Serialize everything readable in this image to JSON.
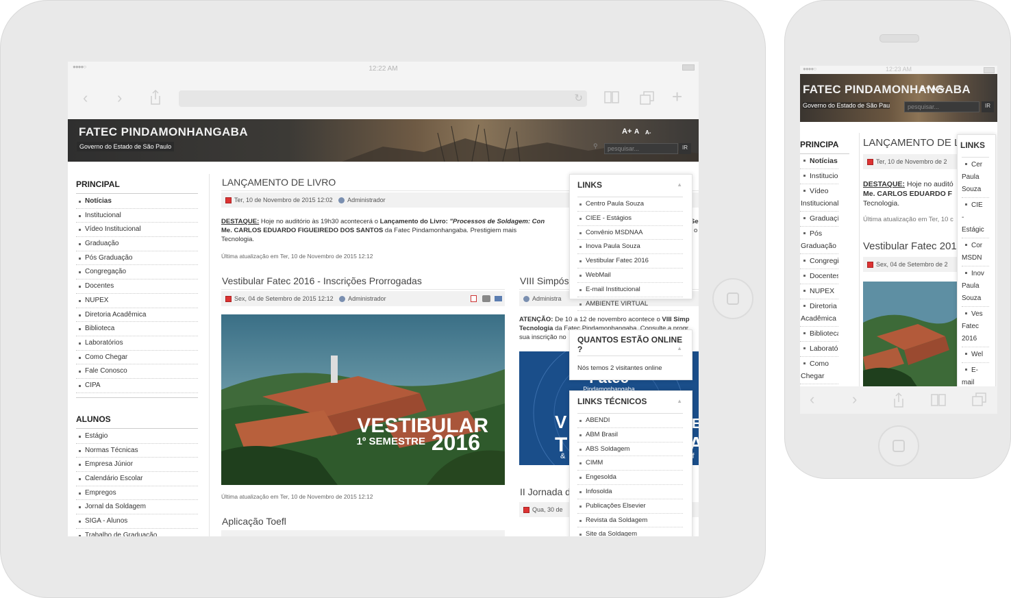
{
  "tablet": {
    "status": {
      "time": "12:22 AM",
      "signal": "●●●●○"
    },
    "header": {
      "title": "FATEC PINDAMONHANGABA",
      "subtitle": "Governo do Estado de São Paulo",
      "font_controls": [
        "A+",
        "A",
        "A-"
      ],
      "search_placeholder": "pesquisar...",
      "search_button": "IR"
    },
    "sidebar": {
      "principal_title": "PRINCIPAL",
      "principal_items": [
        "Notícias",
        "Institucional",
        "Vídeo Institucional",
        "Graduação",
        "Pós Graduação",
        "Congregação",
        "Docentes",
        "NUPEX",
        "Diretoria Acadêmica",
        "Biblioteca",
        "Laboratórios",
        "Como Chegar",
        "Fale Conosco",
        "CIPA"
      ],
      "alunos_title": "ALUNOS",
      "alunos_items": [
        "Estágio",
        "Normas Técnicas",
        "Empresa Júnior",
        "Calendário Escolar",
        "Empregos",
        "Jornal da Soldagem",
        "SIGA - Alunos",
        "Trabalho de Graduação"
      ]
    },
    "article1": {
      "title": "LANÇAMENTO DE LIVRO",
      "date": "Ter, 10 de Novembro de 2015 12:02",
      "author": "Administrador",
      "label": "DESTAQUE:",
      "text1": "Hoje no auditório às 19h30 acontecerá o ",
      "bold1": "Lançamento do Livro: ",
      "italic1": "\"Processos de Soldagem: Con",
      "bold2": "Me. CARLOS EDUARDO FIGUEIREDO DOS SANTOS",
      "text2": " da Fatec Pindamonhangaba. Prestigiem mais",
      "text3": "Tecnologia.",
      "updated": "Última atualização em Ter, 10 de Novembro de 2015 12:12"
    },
    "article2": {
      "title": "Vestibular Fatec 2016 - Inscrições Prorrogadas",
      "date": "Sex, 04 de Setembro de 2015 12:12",
      "author": "Administrador",
      "banner_big": "VESTIBULAR",
      "banner_sem": "1º SEMESTRE",
      "banner_year": "2016",
      "updated": "Última atualização em Ter, 10 de Novembro de 2015 12:12"
    },
    "article3": {
      "title": "VIII Simpós",
      "author": "Administra",
      "label": "ATENÇÃO:",
      "text1": " De 10 a 12 de novembro acontece o ",
      "bold1": "VIII Simp",
      "line2a": "Tecnologia",
      "line2b": " da Fatec Pindamonhangaba. Consulte a progr",
      "line3": "sua inscrição no",
      "banner_top": "Fatec",
      "banner_sub": "Pindamonhangaba",
      "banner_left": "V",
      "banner_left2": "T",
      "banner_amp": "&",
      "banner_right": "E",
      "banner_right2": "A",
      "banner_right3": "if"
    },
    "article4": {
      "title": "Aplicação Toefl"
    },
    "article5": {
      "title": "II Jornada d",
      "date": "Qua, 30 de"
    },
    "panels": {
      "links_title": "LINKS",
      "links": [
        "Centro Paula Souza",
        "CIEE - Estágios",
        "Convênio MSDNAA",
        "Inova Paula Souza",
        "Vestibular Fatec 2016",
        "WebMail",
        "E-mail Institucional",
        "AMBIENTE VIRTUAL"
      ],
      "online_title": "QUANTOS ESTÃO ONLINE ?",
      "online_text": "Nós temos 2 visitantes online",
      "tech_title": "LINKS TÉCNICOS",
      "tech_links": [
        "ABENDI",
        "ABM Brasil",
        "ABS Soldagem",
        "CIMM",
        "Engesolda",
        "Infosolda",
        "Publicações Elsevier",
        "Revista da Soldagem",
        "Site da Soldagem"
      ]
    }
  },
  "phone": {
    "status": {
      "time": "12:23 AM",
      "signal": "●●●●○"
    },
    "header": {
      "title": "FATEC PINDAMONHANGABA",
      "font_controls": "A+ A A-",
      "subtitle": "Governo do Estado de São Pau",
      "search_placeholder": "pesquisar...",
      "search_button": "IR"
    },
    "sidebar_title": "PRINCIPA",
    "sidebar_items": [
      {
        "lines": [
          "Notícias"
        ],
        "bold": true
      },
      {
        "lines": [
          "Institucior"
        ]
      },
      {
        "lines": [
          "Vídeo",
          "Institucional"
        ]
      },
      {
        "lines": [
          "Graduaçí"
        ]
      },
      {
        "lines": [
          "Pós",
          "Graduação"
        ]
      },
      {
        "lines": [
          "Congregi"
        ]
      },
      {
        "lines": [
          "Docentes"
        ]
      },
      {
        "lines": [
          "NUPEX"
        ]
      },
      {
        "lines": [
          "Diretoria",
          "Acadêmica"
        ]
      },
      {
        "lines": [
          "Biblioteca"
        ]
      },
      {
        "lines": [
          "Laborató"
        ]
      },
      {
        "lines": [
          "Como",
          "Chegar"
        ]
      }
    ],
    "article1": {
      "title": "LANÇAMENTO DE L",
      "date": "Ter, 10 de Novembro de 2",
      "label": "DESTAQUE:",
      "text1": " Hoje no auditó",
      "bold": "Me. CARLOS EDUARDO F",
      "text2": "Tecnologia.",
      "updated": "Última atualização em Ter, 10 c"
    },
    "article2": {
      "title": "Vestibular Fatec 201",
      "date": "Sex, 04 de Setembro de 2"
    },
    "links_title": "LINKS",
    "links": [
      {
        "lines": [
          "Cer",
          "Paula",
          "Souza"
        ]
      },
      {
        "lines": [
          "CIE",
          "-",
          "Estágic"
        ]
      },
      {
        "lines": [
          "Cor",
          "MSDN"
        ]
      },
      {
        "lines": [
          "Inov",
          "Paula",
          "Souza"
        ]
      },
      {
        "lines": [
          "Ves",
          "Fatec",
          "2016"
        ]
      },
      {
        "lines": [
          "Wel"
        ]
      },
      {
        "lines": [
          "E-",
          "mail"
        ]
      }
    ]
  },
  "colors": {
    "device": "#e9e9e9",
    "header_dark": "#2f2f2f",
    "meta_bg": "#f1f1f1",
    "accent_red": "#d33"
  }
}
